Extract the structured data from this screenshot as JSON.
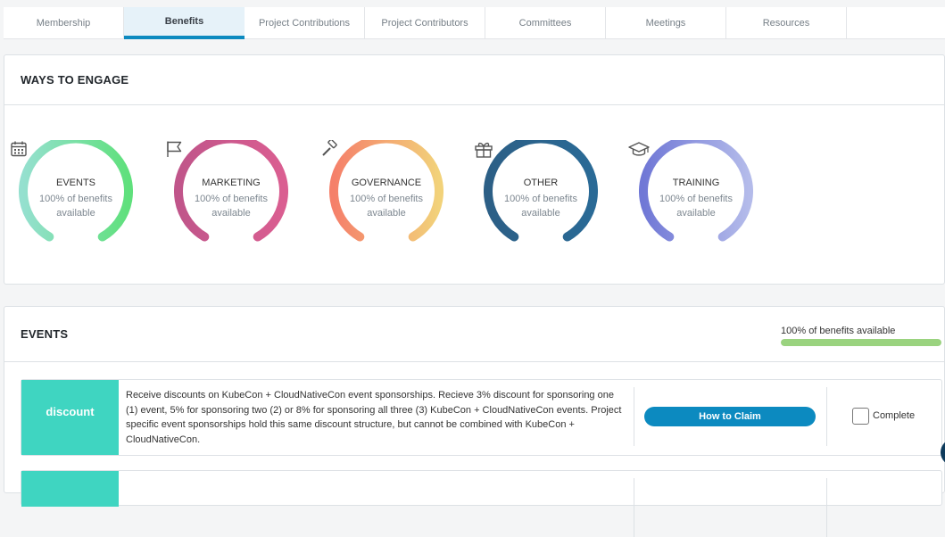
{
  "tabs": [
    {
      "label": "Membership",
      "active": false
    },
    {
      "label": "Benefits",
      "active": true
    },
    {
      "label": "Project Contributions",
      "active": false
    },
    {
      "label": "Project Contributors",
      "active": false
    },
    {
      "label": "Committees",
      "active": false
    },
    {
      "label": "Meetings",
      "active": false
    },
    {
      "label": "Resources",
      "active": false
    }
  ],
  "engage": {
    "title": "WAYS TO ENGAGE",
    "gauges": [
      {
        "title": "EVENTS",
        "line1": "100% of benefits",
        "line2": "available",
        "icon": "calendar-icon",
        "color_start": "#95e0cf",
        "color_end": "#5fe07c",
        "percent": 100
      },
      {
        "title": "MARKETING",
        "line1": "100% of benefits",
        "line2": "available",
        "icon": "flag-icon",
        "color_start": "#c0558a",
        "color_end": "#da5e91",
        "percent": 100
      },
      {
        "title": "GOVERNANCE",
        "line1": "100% of benefits",
        "line2": "available",
        "icon": "gavel-icon",
        "color_start": "#f5806a",
        "color_end": "#f2d27a",
        "percent": 100
      },
      {
        "title": "OTHER",
        "line1": "100% of benefits",
        "line2": "available",
        "icon": "gift-icon",
        "color_start": "#2c5f86",
        "color_end": "#2a6a96",
        "percent": 100
      },
      {
        "title": "TRAINING",
        "line1": "100% of benefits",
        "line2": "available",
        "icon": "graduation-cap-icon",
        "color_start": "#7078d6",
        "color_end": "#b4bbea",
        "percent": 100
      }
    ]
  },
  "events": {
    "title": "EVENTS",
    "progress_text": "100% of benefits available",
    "progress": 1.0,
    "progress_color": "#9ad37f",
    "benefits": [
      {
        "tag": "discount",
        "description": "Receive discounts on KubeCon + CloudNativeCon event sponsorships. Recieve 3% discount for sponsoring one (1) event, 5% for sponsoring two (2) or 8% for sponsoring all three (3) KubeCon + CloudNativeCon events. Project specific event sponsorships hold this same discount structure, but cannot be combined with KubeCon + CloudNativeCon.",
        "claim_label": "How to Claim",
        "complete_label": "Complete"
      }
    ]
  },
  "colors": {
    "accent": "#0c8ac0",
    "tag": "#3fd5c1"
  }
}
